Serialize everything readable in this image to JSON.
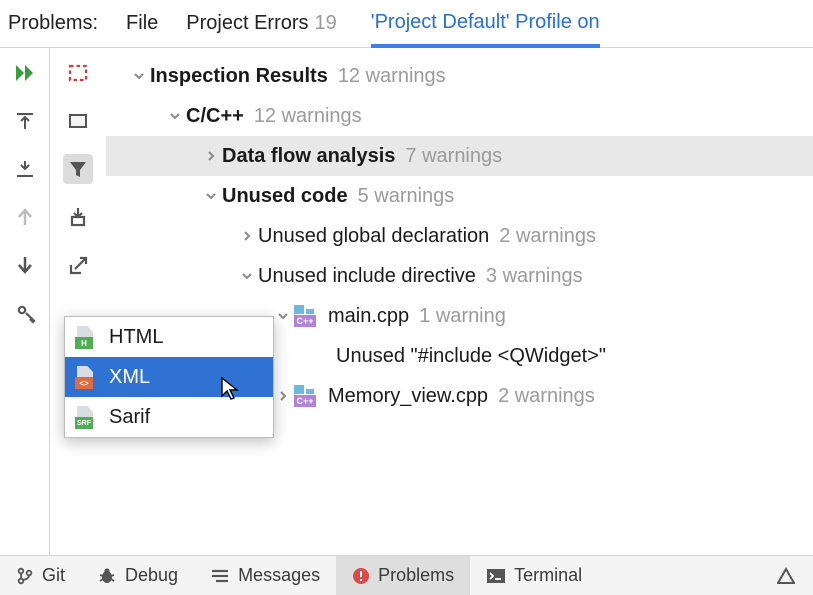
{
  "tabs": {
    "problems_label": "Problems:",
    "file": "File",
    "project_errors": "Project Errors",
    "project_errors_count": "19",
    "active": "'Project Default' Profile on"
  },
  "tree": {
    "root_label": "Inspection Results",
    "root_count": "12 warnings",
    "cpp_label": "C/C++",
    "cpp_count": "12 warnings",
    "dfa_label": "Data flow analysis",
    "dfa_count": "7 warnings",
    "unused_label": "Unused code",
    "unused_count": "5 warnings",
    "ugl_label": "Unused global declaration",
    "ugl_count": "2 warnings",
    "uid_label": "Unused include directive",
    "uid_count": "3 warnings",
    "main_file": "main.cpp",
    "main_count": "1 warning",
    "main_detail": "Unused \"#include <QWidget>\"",
    "mem_file": "Memory_view.cpp",
    "mem_count": "2 warnings"
  },
  "popup": {
    "html": "HTML",
    "xml": "XML",
    "sarif": "Sarif"
  },
  "status": {
    "git": "Git",
    "debug": "Debug",
    "messages": "Messages",
    "problems": "Problems",
    "terminal": "Terminal"
  }
}
